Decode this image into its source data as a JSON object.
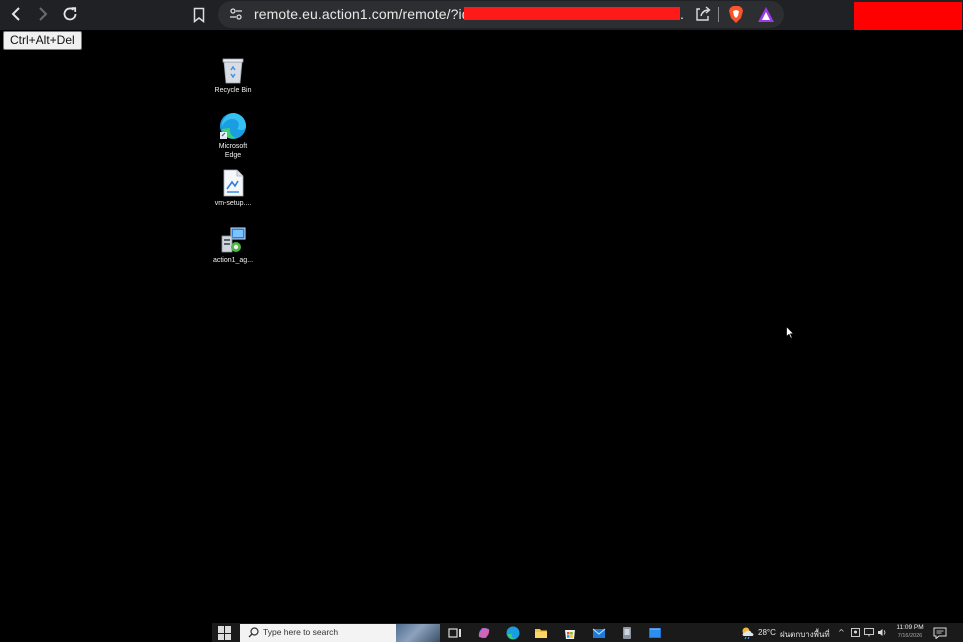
{
  "browser": {
    "url": "remote.eu.action1.com/remote/?id=bc",
    "url_trailing": ".",
    "nav": {
      "back_icon": "chevron-left-icon",
      "forward_icon": "chevron-right-icon",
      "reload_icon": "reload-icon"
    },
    "toolbar_icons": [
      "bookmark-icon",
      "site-settings-icon",
      "share-icon",
      "brave-shield-icon",
      "brave-rewards-icon"
    ],
    "colors": {
      "bar": "#202124",
      "address": "#2d2e31",
      "redaction": "#ff0000",
      "shield": "#fb542b"
    }
  },
  "remote": {
    "ctrl_alt_del_label": "Ctrl+Alt+Del"
  },
  "desktop": {
    "icons": [
      {
        "label": "Recycle Bin",
        "icon": "recycle-bin-icon"
      },
      {
        "label": "Microsoft Edge",
        "icon": "edge-icon"
      },
      {
        "label": "vm-setup....",
        "icon": "file-icon"
      },
      {
        "label": "action1_ag...",
        "icon": "installer-icon"
      }
    ]
  },
  "taskbar": {
    "search_placeholder": "Type here to search",
    "pinned_icons": [
      "task-view-icon",
      "copilot-icon",
      "edge-icon",
      "file-explorer-icon",
      "store-icon",
      "mail-icon",
      "app-icon",
      "terminal-icon"
    ],
    "weather": {
      "temperature": "28°C",
      "condition": "ฝนตกบางพื้นที่"
    },
    "tray_icons": [
      "chevron-up-icon",
      "meet-icon",
      "network-icon",
      "volume-icon"
    ],
    "time": "11:09 PM",
    "date": "7/16/2026"
  }
}
